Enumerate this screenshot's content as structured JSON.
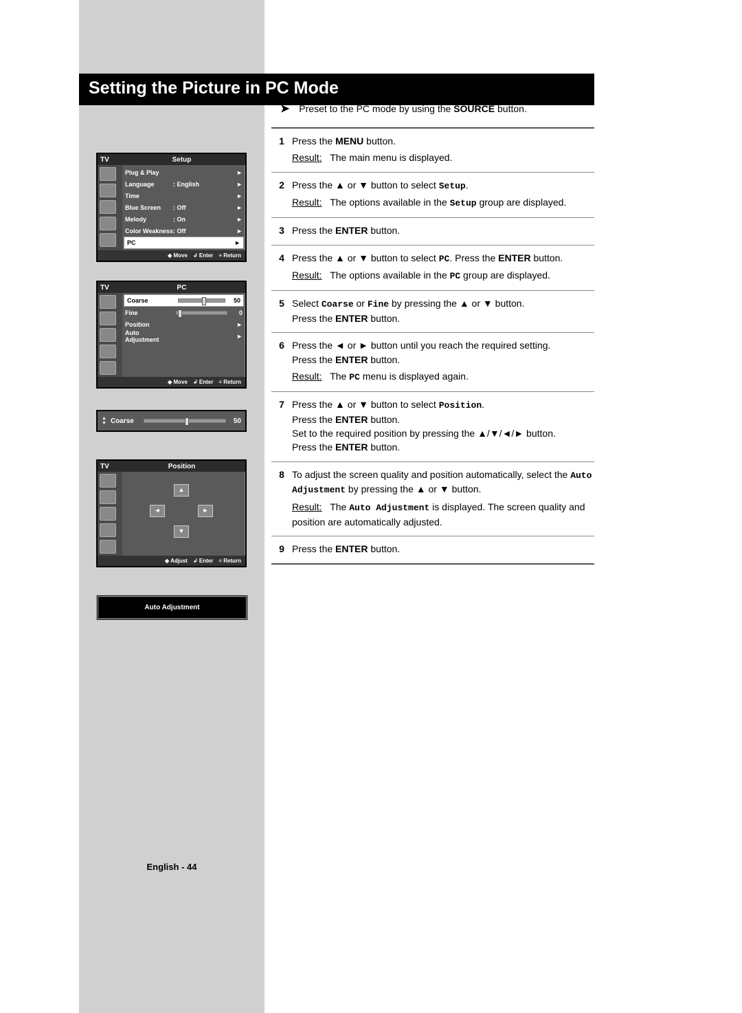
{
  "title": "Setting the Picture in PC Mode",
  "intro": {
    "pre": "Preset to the PC mode by using the ",
    "bold": "SOURCE",
    "post": " button."
  },
  "steps": [
    {
      "num": "1",
      "lines": [
        "Press the <b>MENU</b> button."
      ],
      "result": "The main menu is displayed."
    },
    {
      "num": "2",
      "lines": [
        "Press the <span class='sym'>▲</span> or <span class='sym'>▼</span> button to select <span class='mono'><b>Setup</b></span>."
      ],
      "result": "The options available in the <span class='mono'><b>Setup</b></span> group are displayed."
    },
    {
      "num": "3",
      "lines": [
        "Press the <b>ENTER</b> button."
      ]
    },
    {
      "num": "4",
      "lines": [
        "Press the <span class='sym'>▲</span> or <span class='sym'>▼</span> button to select <span class='mono'><b>PC</b></span>. Press the <b>ENTER</b> button."
      ],
      "result": "The options available in the <span class='mono'><b>PC</b></span> group are displayed."
    },
    {
      "num": "5",
      "lines": [
        "Select <span class='mono'><b>Coarse</b></span> or <span class='mono'><b>Fine</b></span> by pressing the <span class='sym'>▲</span> or <span class='sym'>▼</span> button.<br>Press the <b>ENTER</b> button."
      ]
    },
    {
      "num": "6",
      "lines": [
        "Press the <span class='sym'>◄</span> or <span class='sym'>►</span> button until you reach the required setting.<br>Press the <b>ENTER</b> button."
      ],
      "result": "The <span class='mono'><b>PC</b></span> menu is displayed again."
    },
    {
      "num": "7",
      "lines": [
        "Press the <span class='sym'>▲</span> or <span class='sym'>▼</span> button to select <span class='mono'><b>Position</b></span>.<br>Press the <b>ENTER</b> button.<br>Set to the required position by pressing the <span class='sym'>▲</span>/<span class='sym'>▼</span>/<span class='sym'>◄</span>/<span class='sym'>►</span> button.<br>Press the <b>ENTER</b> button."
      ]
    },
    {
      "num": "8",
      "lines": [
        "To adjust the screen quality and position automatically, select the <span class='mono'><b>Auto Adjustment</b></span> by pressing the <span class='sym'>▲</span> or <span class='sym'>▼</span> button."
      ],
      "result": "The <span class='mono'><b>Auto Adjustment</b></span> is displayed. The screen quality and position are automatically adjusted."
    },
    {
      "num": "9",
      "lines": [
        "Press the <b>ENTER</b> button."
      ]
    }
  ],
  "osd_setup": {
    "tv": "TV",
    "title": "Setup",
    "rows": [
      {
        "l": "Plug & Play",
        "v": "",
        "arrow": true
      },
      {
        "l": "Language",
        "v": ": English",
        "arrow": true
      },
      {
        "l": "Time",
        "v": "",
        "arrow": true
      },
      {
        "l": "Blue Screen",
        "v": ": Off",
        "arrow": true
      },
      {
        "l": "Melody",
        "v": ": On",
        "arrow": true
      },
      {
        "l": "Color Weakness",
        "v": ": Off",
        "arrow": true
      },
      {
        "l": "PC",
        "v": "",
        "arrow": true,
        "sel": true
      }
    ],
    "footer": [
      "Move",
      "Enter",
      "Return"
    ]
  },
  "osd_pc": {
    "tv": "TV",
    "title": "PC",
    "rows": [
      {
        "l": "Coarse",
        "slider": 50,
        "val": "50",
        "sel": true
      },
      {
        "l": "Fine",
        "slider": 3,
        "val": "0"
      },
      {
        "l": "Position",
        "arrow": true
      },
      {
        "l": "Auto Adjustment",
        "arrow": true
      }
    ],
    "footer": [
      "Move",
      "Enter",
      "Return"
    ]
  },
  "coarse_strip": {
    "label": "Coarse",
    "value": "50",
    "slider": 50
  },
  "osd_position": {
    "tv": "TV",
    "title": "Position",
    "footer": [
      "Adjust",
      "Enter",
      "Return"
    ]
  },
  "auto_adj": "Auto Adjustment",
  "page_footer": "English - 44",
  "footer_icons": {
    "move": "◆",
    "enter": "↲",
    "return": "≡"
  },
  "result_label": "Result:"
}
